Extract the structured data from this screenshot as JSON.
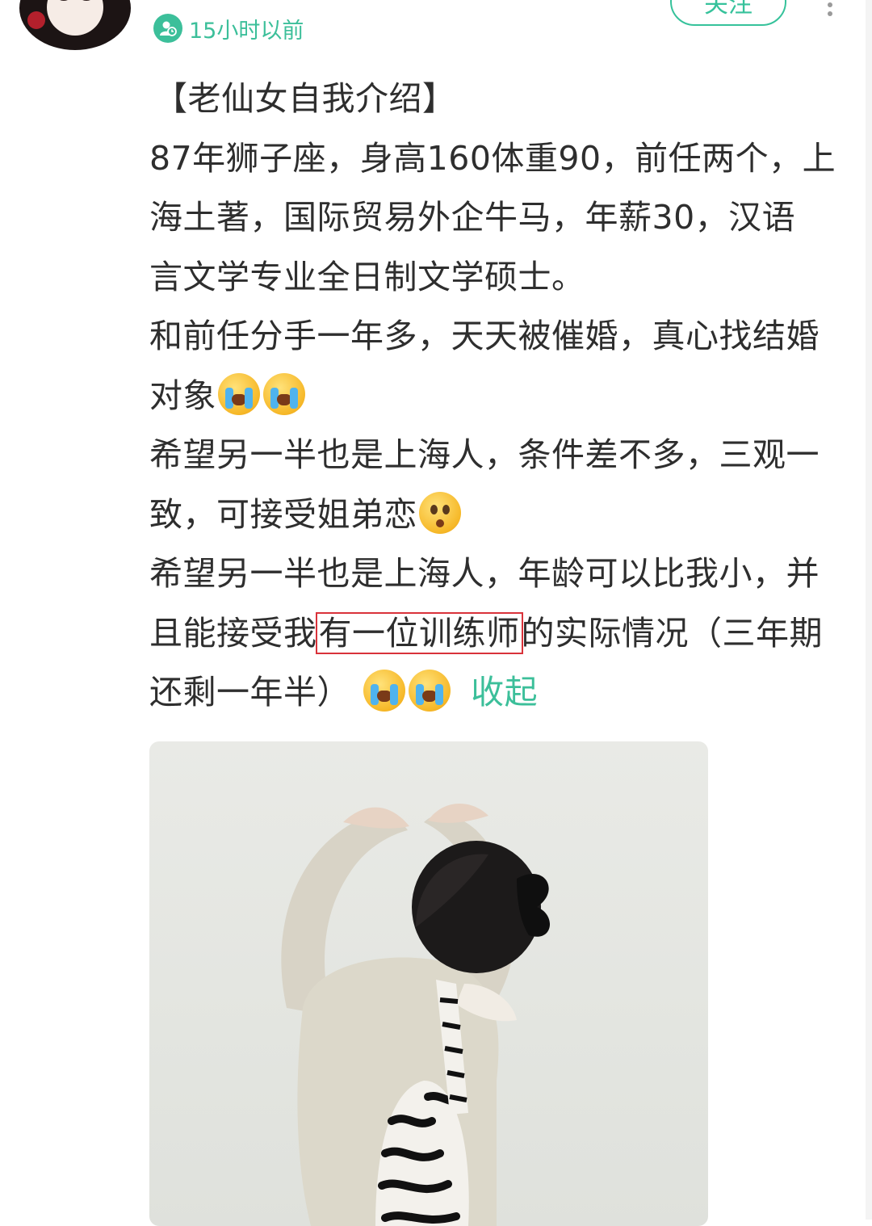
{
  "header": {
    "time_label": "15小时以前",
    "follow_label": "关注"
  },
  "post": {
    "lines": [
      "【老仙女自我介绍】",
      "87年狮子座，身高160体重90，前任两个，上",
      "海土著，国际贸易外企牛马，年薪30，汉语",
      "言文学专业全日制文学硕士。",
      "和前任分手一年多，天天被催婚，真心找结婚",
      "对象",
      "希望另一半也是上海人，条件差不多，三观一",
      "致，可接受姐弟恋",
      "希望另一半也是上海人，年龄可以比我小，并",
      "且能接受我",
      "有一位训练师",
      "的实际情况（三年期",
      "还剩一年半）"
    ],
    "collapse_label": "收起"
  },
  "icons": {
    "time_icon": "user-clock-icon",
    "more_icon": "more-vertical-icon",
    "emoji_cry": "loudly-crying-face-emoji",
    "emoji_flushed": "flushed-face-emoji"
  },
  "colors": {
    "accent": "#3cbf9a",
    "highlight_box": "#d9323a",
    "text": "#2e2e2e"
  }
}
